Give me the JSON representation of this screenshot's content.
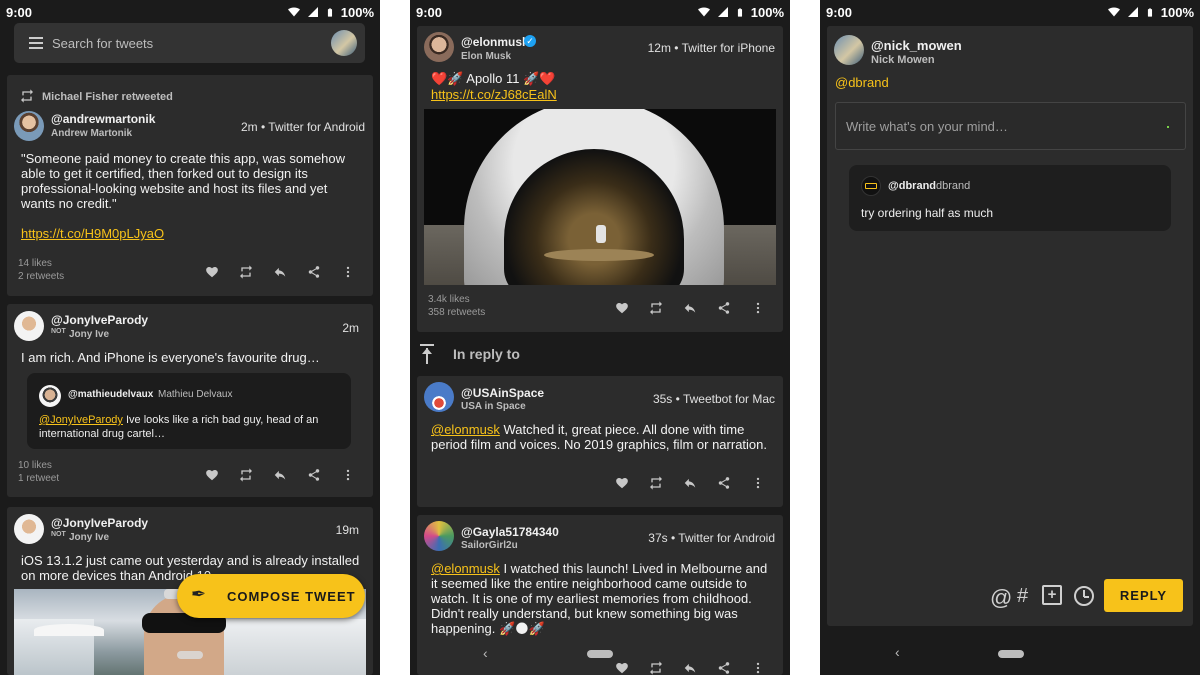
{
  "status": {
    "time": "9:00",
    "battery": "100%"
  },
  "screen1": {
    "search_placeholder": "Search for tweets",
    "tweet1": {
      "retweeted_by": "Michael Fisher retweeted",
      "handle": "@andrewmartonik",
      "name": "Andrew Martonik",
      "meta": "2m • Twitter for Android",
      "body_lines": [
        "\"Someone paid money to create this app, was somehow",
        "able to get it certified, then forked out to design its",
        "professional-looking website and host its files and yet",
        "wants no credit.\""
      ],
      "link": "https://t.co/H9M0pLJyaO",
      "likes": "14 likes",
      "retweets": "2 retweets"
    },
    "tweet2": {
      "handle": "@JonyIveParody",
      "not": "NOT",
      "name": "Jony Ive",
      "meta": "2m",
      "body": "I am rich. And iPhone is everyone's favourite drug…",
      "quote": {
        "handle": "@mathieudelvaux",
        "name": "Mathieu Delvaux",
        "mention": "@JonyIveParody",
        "text1": " Ive looks like a rich bad guy, head of an",
        "text2": "international drug cartel…"
      },
      "likes": "10 likes",
      "retweets": "1 retweet"
    },
    "tweet3": {
      "handle": "@JonyIveParody",
      "not": "NOT",
      "name": "Jony Ive",
      "meta": "19m",
      "body_lines": [
        "iOS 13.1.2 just came out yesterday and is already installed",
        "on more devices than Android 10"
      ]
    },
    "fab": "COMPOSE TWEET"
  },
  "screen2": {
    "main": {
      "handle": "@elonmusk",
      "name": "Elon Musk",
      "meta": "12m • Twitter for iPhone",
      "body": "❤️🚀 Apollo 11 🚀❤️",
      "link": "https://t.co/zJ68cEalN",
      "likes": "3.4k likes",
      "retweets": "358 retweets"
    },
    "in_reply_to": "In reply to",
    "reply1": {
      "handle": "@USAinSpace",
      "name": "USA in Space",
      "meta": "35s • Tweetbot for Mac",
      "mention": "@elonmusk",
      "text1": " Watched it, great piece. All done with time",
      "text2": "period film and voices.  No 2019 graphics, film or narration."
    },
    "reply2": {
      "handle": "@Gayla51784340",
      "name": "SailorGirl2u",
      "meta": "37s • Twitter for Android",
      "mention": "@elonmusk",
      "text1": " I watched this launch! Lived in Melbourne and",
      "lines": [
        "it seemed like the entire neighborhood came outside to",
        "watch. It is one of my earliest memories from childhood.",
        "Didn't really understand, but knew something big was",
        "happening. 🚀🌑🚀"
      ]
    }
  },
  "screen3": {
    "handle": "@nick_mowen",
    "name": "Nick Mowen",
    "reply_to": "@dbrand",
    "input_placeholder": "Write what's on your mind…",
    "quoted": {
      "handle": "@dbrand",
      "name": "dbrand",
      "body": "try ordering half as much"
    },
    "reply_button": "REPLY",
    "at_symbol": "@",
    "hash_symbol": "#"
  },
  "colors": {
    "accent": "#f7c21a",
    "card": "#2c2c2c",
    "bg": "#1b1b1b"
  }
}
